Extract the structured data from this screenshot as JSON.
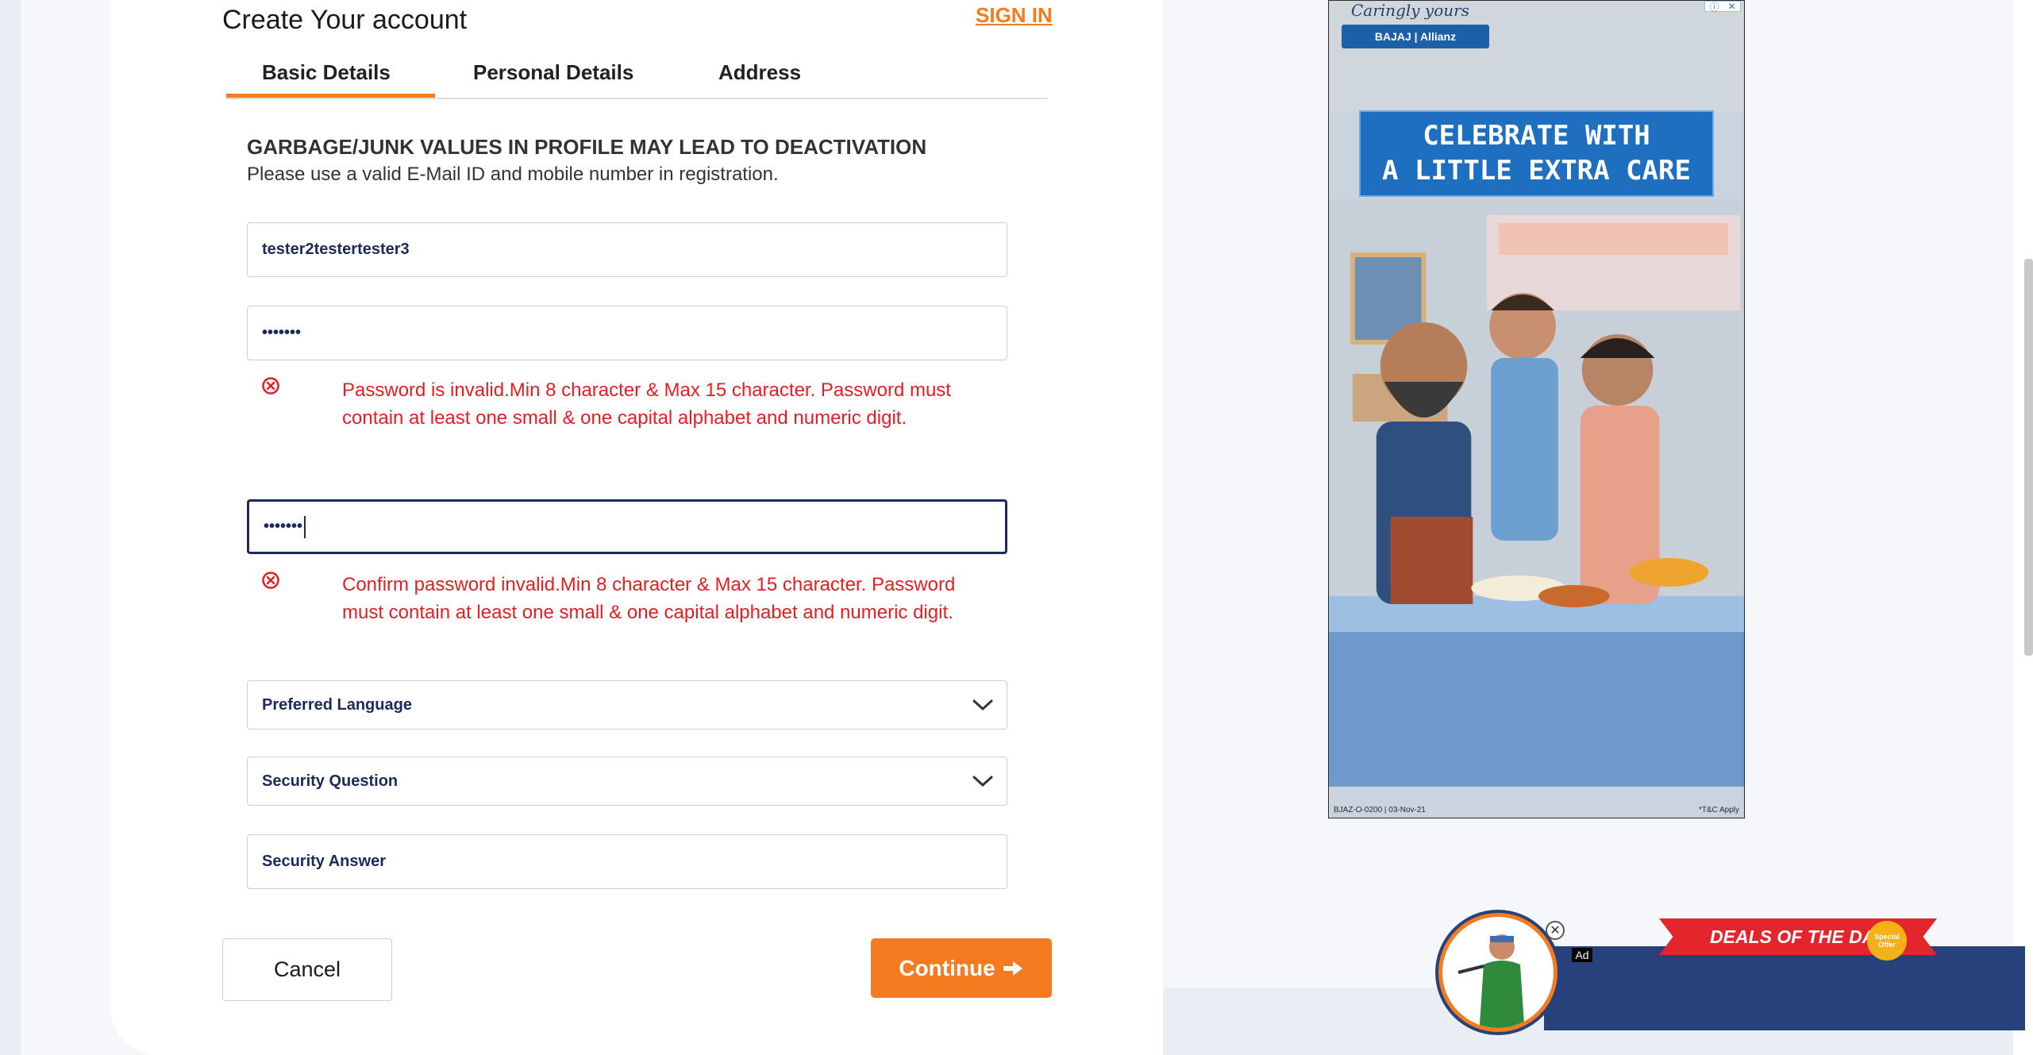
{
  "header": {
    "title": "Create Your account",
    "sign_in": "SIGN IN"
  },
  "tabs": [
    {
      "label": "Basic Details",
      "active": true
    },
    {
      "label": "Personal Details",
      "active": false
    },
    {
      "label": "Address",
      "active": false
    }
  ],
  "notice": {
    "title": "GARBAGE/JUNK VALUES IN PROFILE MAY LEAD TO DEACTIVATION",
    "subtitle": "Please use a valid E-Mail ID and mobile number in registration."
  },
  "form": {
    "username": "tester2testertester3",
    "password_mask": "•••••••",
    "password_error": "Password is invalid.Min 8 character & Max 15 character. Password must contain at least one small & one capital alphabet and numeric digit.",
    "confirm_mask": "•••••••",
    "confirm_error": "Confirm password invalid.Min 8 character & Max 15 character. Password must contain at least one small & one capital alphabet and numeric digit.",
    "preferred_language": "Preferred Language",
    "security_question": "Security Question",
    "security_answer": "Security Answer"
  },
  "buttons": {
    "cancel": "Cancel",
    "continue": "Continue"
  },
  "ad": {
    "tagline": "Caringly yours",
    "brand": "BAJAJ | Allianz",
    "headline_1": "CELEBRATE WITH",
    "headline_2": "A LITTLE EXTRA CARE",
    "footer_left": "BJAZ-O-0200 | 03-Nov-21",
    "footer_right": "*T&C Apply"
  },
  "bottom_ad": {
    "ribbon": "DEALS OF THE DAY",
    "badge": "Special Offer",
    "label": "Ad"
  },
  "colors": {
    "accent": "#f47b20",
    "error": "#e31e24",
    "field_text": "#1c2a5a"
  }
}
